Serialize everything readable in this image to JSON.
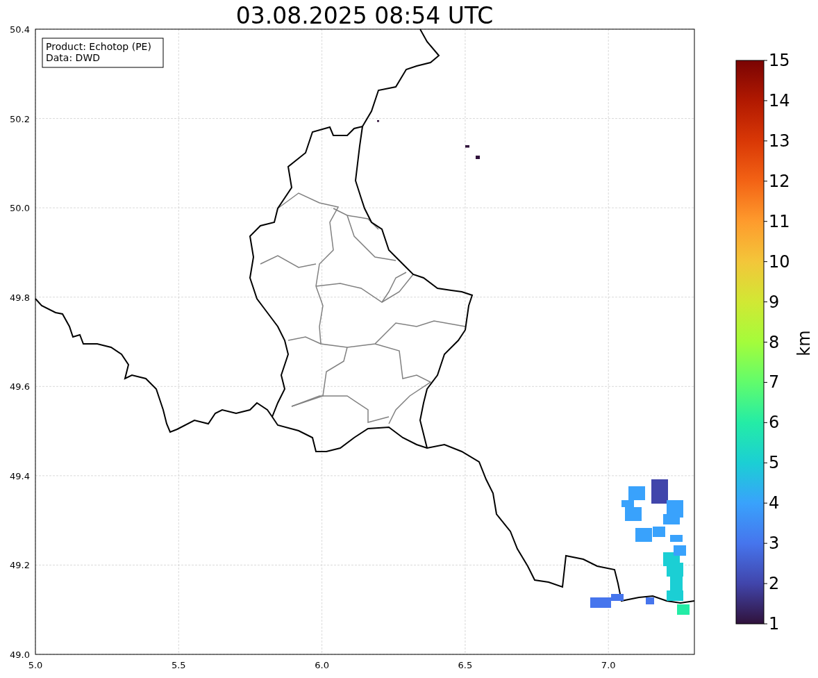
{
  "title": "03.08.2025 08:54 UTC",
  "legend": [
    "Product: Echotop (PE)",
    "Data: DWD"
  ],
  "x_ticks": [
    "5.0",
    "5.5",
    "6.0",
    "6.5",
    "7.0"
  ],
  "y_ticks": [
    "50.4",
    "50.2",
    "50.0",
    "49.8",
    "49.6",
    "49.4",
    "49.2",
    "49.0"
  ],
  "colorbar": {
    "label": "km",
    "ticks": [
      "15",
      "14",
      "13",
      "12",
      "11",
      "10",
      "9",
      "8",
      "7",
      "6",
      "5",
      "4",
      "3",
      "2",
      "1"
    ]
  }
}
